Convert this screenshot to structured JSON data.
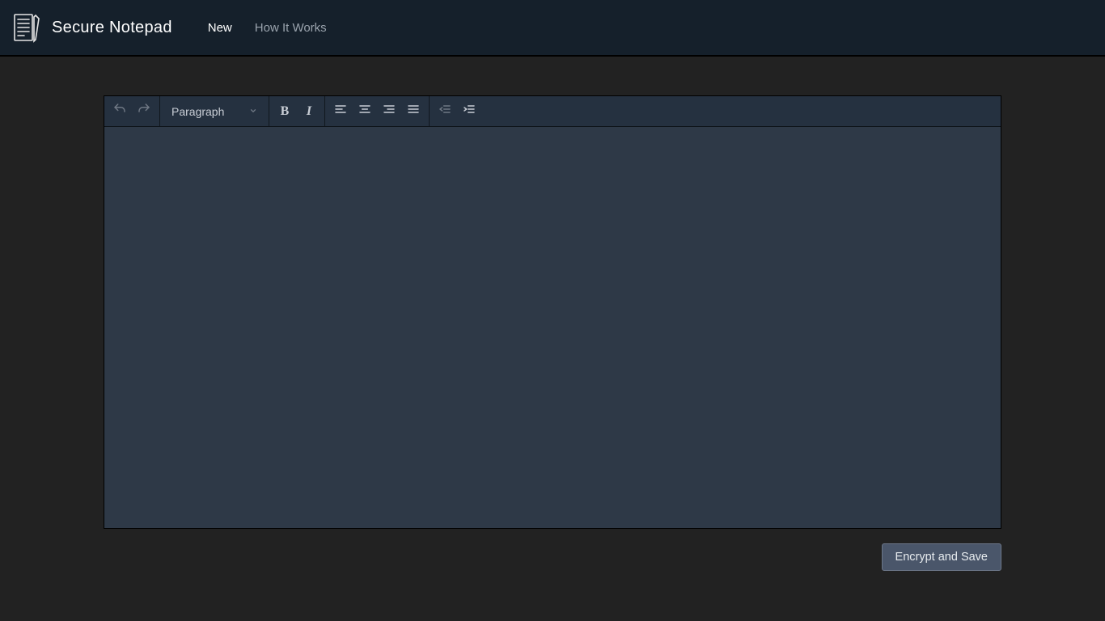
{
  "header": {
    "app_title": "Secure Notepad",
    "nav": {
      "new": "New",
      "how": "How It Works"
    }
  },
  "toolbar": {
    "block_select": "Paragraph",
    "icons": {
      "undo": "undo",
      "redo": "redo",
      "bold": "B",
      "italic": "I",
      "align_left": "align-left",
      "align_center": "align-center",
      "align_right": "align-right",
      "align_justify": "align-justify",
      "outdent": "outdent",
      "indent": "indent"
    }
  },
  "editor": {
    "content": ""
  },
  "actions": {
    "encrypt_save": "Encrypt and Save"
  },
  "colors": {
    "bg": "#222222",
    "header_bg": "#15202b",
    "toolbar_bg": "#253140",
    "editor_bg": "#2e3947",
    "button_bg": "#4a566a"
  }
}
